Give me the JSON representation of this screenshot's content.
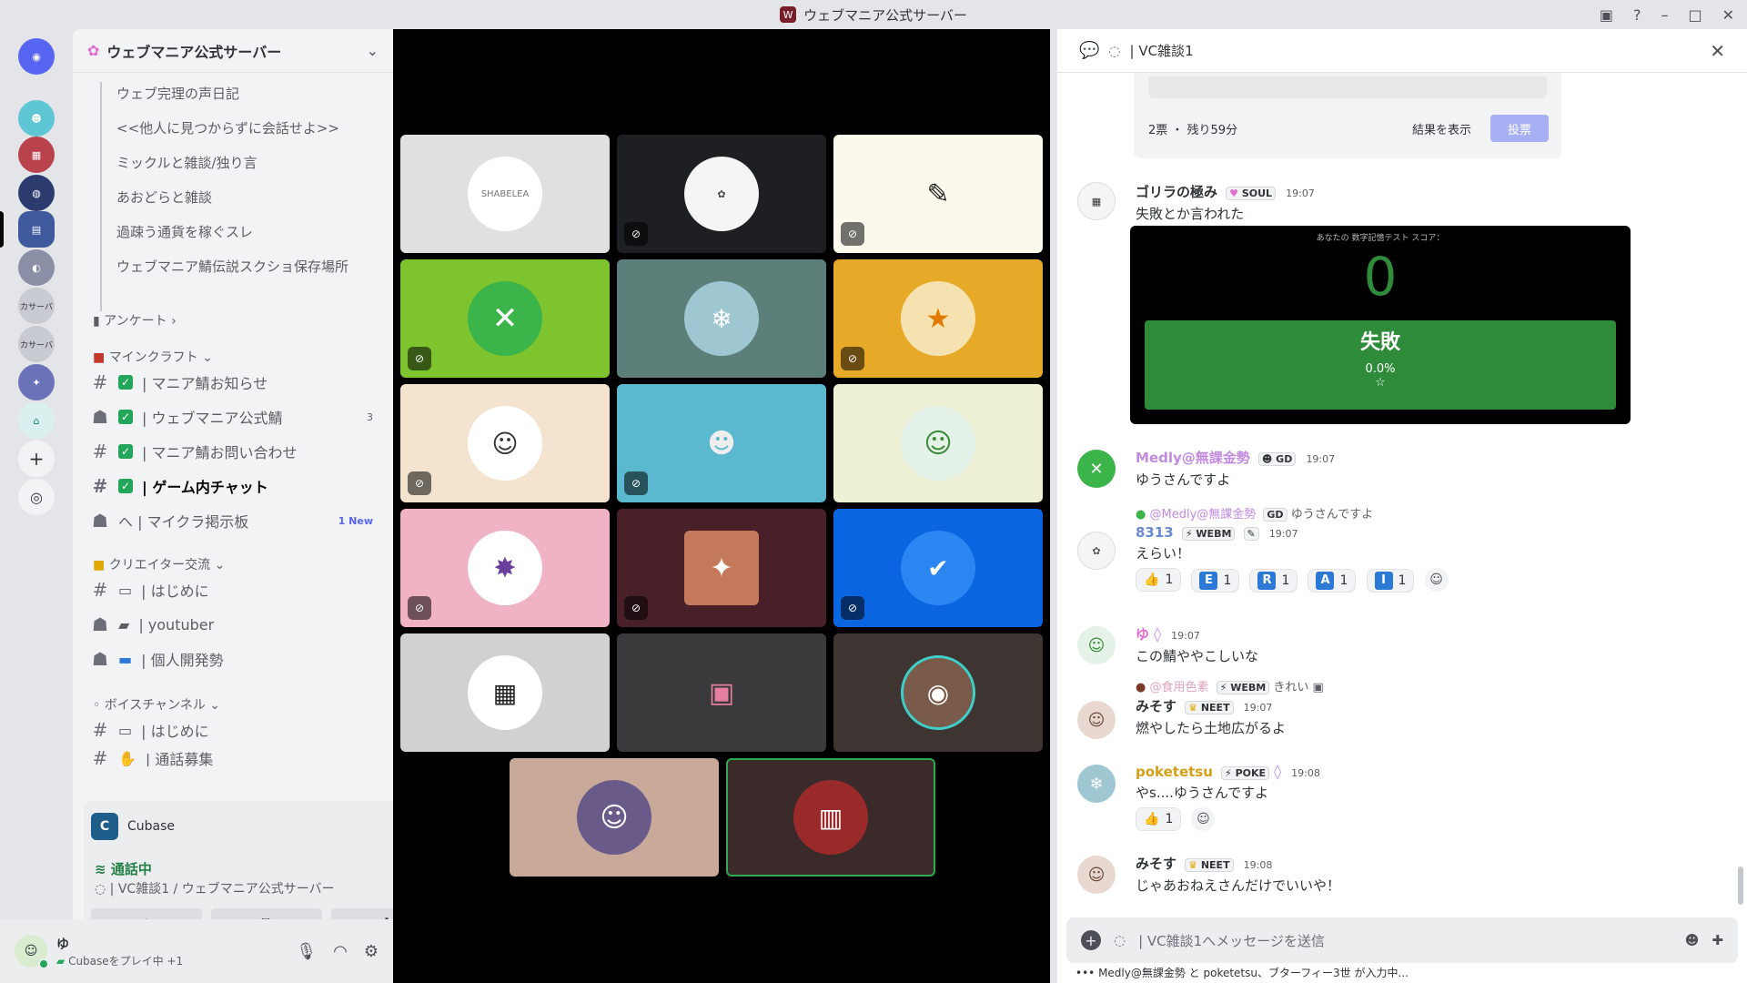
{
  "window": {
    "title": "ウェブマニア公式サーバー"
  },
  "server": {
    "name": "ウェブマニア公式サーバー"
  },
  "rail": {
    "label_a": "カサーバ",
    "label_b": "カサーバ"
  },
  "threads": [
    "ウェブ完理の声日記",
    "<<他人に見つからずに会話せよ>>",
    "ミックルと雑談/独り言",
    "あおどらと雑談",
    "過疎う通貨を稼ぐスレ",
    "ウェブマニア鯖伝説スクショ保存場所"
  ],
  "categories": {
    "survey": "アンケート",
    "minecraft": "マインクラフト",
    "creator": "クリエイター交流",
    "voice": "ボイスチャンネル"
  },
  "channels": {
    "mc_news": "| マニア鯖お知らせ",
    "mc_official": "| ウェブマニア公式鯖",
    "mc_official_count": "3",
    "mc_contact": "| マニア鯖お問い合わせ",
    "mc_ingame": "| ゲーム内チャット",
    "mc_board": "ヘ | マイクラ掲示板",
    "mc_board_new": "1 New",
    "cr_intro": "| はじめに",
    "cr_youtuber": "| youtuber",
    "cr_dev": "| 個人開発勢",
    "vc_intro": "| はじめに",
    "vc_recruit": "| 通話募集"
  },
  "activity": {
    "app": "Cubase",
    "status": "通話中",
    "channel": "| VC雑談1 / ウェブマニア公式サーバー"
  },
  "user": {
    "name": "ゆ",
    "status": "Cubaseをプレイ中 +1"
  },
  "chat": {
    "channel": "| VC雑談1",
    "poll_meta": "2票 ・ 残り59分",
    "poll_results": "結果を表示",
    "poll_vote": "投票",
    "m1_name": "ゴリラの極み",
    "m1_badge": "SOUL",
    "m1_time": "19:07",
    "m1_text": "失敗とか言われた",
    "embed_header": "あなたの 数字記憶テスト スコア：",
    "embed_score": "0",
    "embed_fail": "失敗",
    "embed_pct": "0.0%",
    "embed_star": "☆",
    "m2_name": "Medly@無課金勢",
    "m2_badge": "GD",
    "m2_time": "19:07",
    "m2_text": "ゆうさんですよ",
    "m3_reply_name": "@Medly@無課金勢",
    "m3_reply_badge": "GD",
    "m3_reply_text": "ゆうさんですよ",
    "m3_name": "8313",
    "m3_badge": "WEBM",
    "m3_time": "19:07",
    "m3_text": "えらい！",
    "m3_reactions": [
      {
        "emoji": "👍",
        "count": "1"
      },
      {
        "emoji": "E",
        "count": "1"
      },
      {
        "emoji": "R",
        "count": "1"
      },
      {
        "emoji": "A",
        "count": "1"
      },
      {
        "emoji": "I",
        "count": "1"
      }
    ],
    "m4_name": "ゆ",
    "m4_time": "19:07",
    "m4_text": "この鯖ややこしいな",
    "m5_reply_name": "@食用色素",
    "m5_reply_badge": "WEBM",
    "m5_reply_text": "きれい",
    "m5_name": "みそす",
    "m5_badge": "NEET",
    "m5_time": "19:07",
    "m5_text": "燃やしたら土地広がるよ",
    "m6_name": "poketetsu",
    "m6_badge": "POKE",
    "m6_time": "19:08",
    "m6_text": "やs....ゆうさんですよ",
    "m6_react_count": "1",
    "m7_name": "みそす",
    "m7_badge": "NEET",
    "m7_time": "19:08",
    "m7_text": "じゃあおねえさんだけでいいや！",
    "composer_placeholder": "| VC雑談1へメッセージを送信",
    "typing": "Medly@無課金勢 と poketetsu、ブターフィー3世 が入力中..."
  },
  "tiles": {
    "t1_label": "SHABELEA"
  },
  "colors": {
    "accent": "#5865f2",
    "online": "#23a55a",
    "embed_fail": "#2e8b3a"
  }
}
